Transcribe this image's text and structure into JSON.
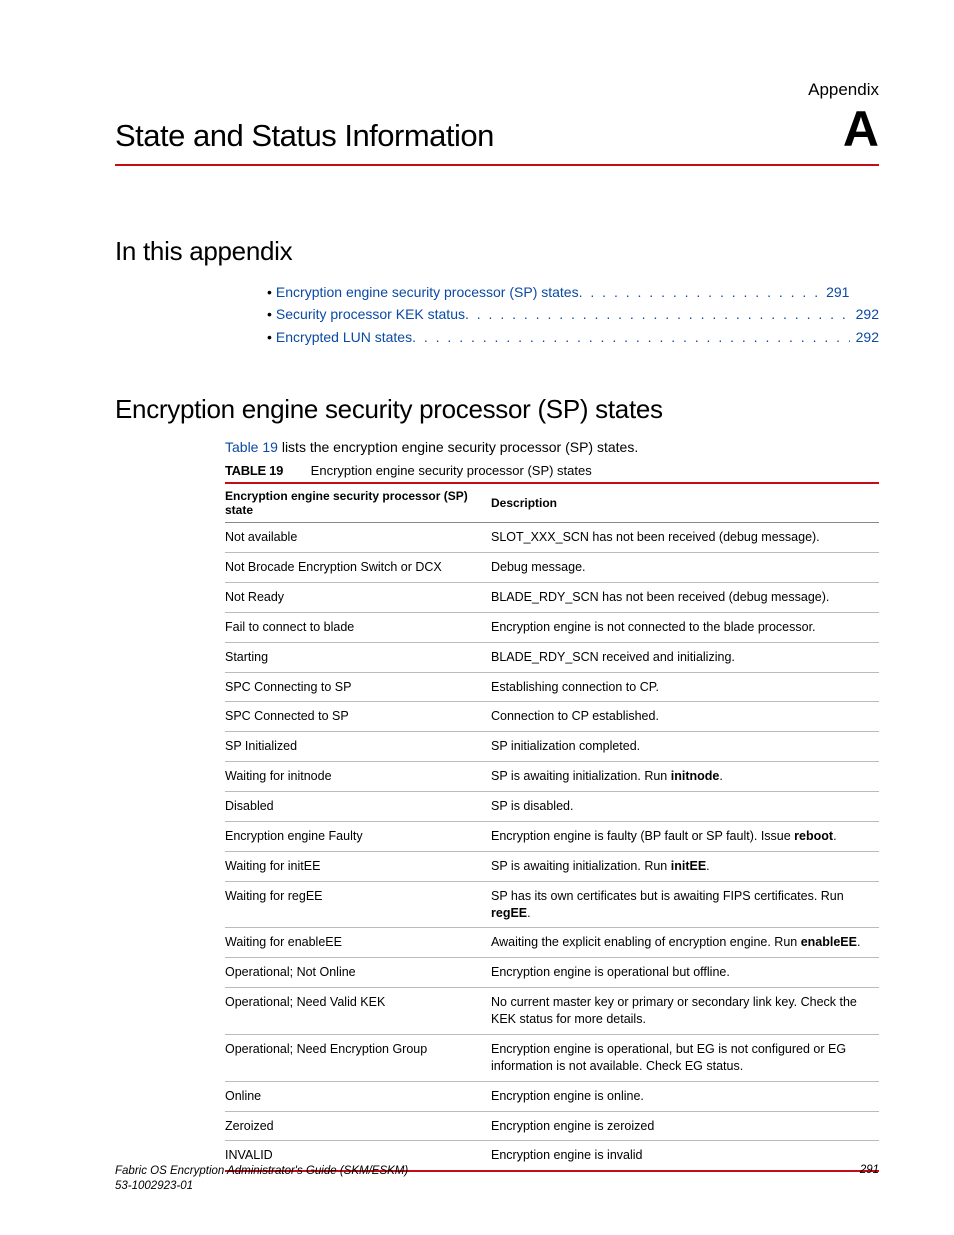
{
  "appendix_label": "Appendix",
  "chapter_title": "State and Status Information",
  "chapter_letter": "A",
  "toc_heading": "In this appendix",
  "toc": [
    {
      "label": "Encryption engine security processor (SP) states",
      "dots": ". . . . . . . . . . . . . . . . . . . . .",
      "page": "291"
    },
    {
      "label": "Security processor KEK status",
      "dots": " . . . . . . . . . . . . . . . . . . . . . . . . . . . . . . . . . . .",
      "page": "292"
    },
    {
      "label": "Encrypted LUN states",
      "dots": " . . . . . . . . . . . . . . . . . . . . . . . . . . . . . . . . . . . . . . . . . .",
      "page": "292"
    }
  ],
  "section_heading": "Encryption engine security processor (SP) states",
  "intro": {
    "link": "Table 19",
    "rest": " lists the encryption engine security processor (SP) states."
  },
  "table": {
    "number": "TABLE 19",
    "caption": "Encryption engine security processor (SP) states",
    "headers": {
      "state": "Encryption engine security processor (SP) state",
      "desc": "Description"
    },
    "rows": [
      {
        "state": "Not available",
        "desc": "SLOT_XXX_SCN has not been received (debug message)."
      },
      {
        "state": "Not Brocade Encryption Switch or DCX",
        "desc": "Debug message."
      },
      {
        "state": "Not Ready",
        "desc": "BLADE_RDY_SCN has not been received (debug message)."
      },
      {
        "state": "Fail to connect to blade",
        "desc": "Encryption engine is not connected to the blade processor."
      },
      {
        "state": "Starting",
        "desc": "BLADE_RDY_SCN received and initializing."
      },
      {
        "state": "SPC Connecting to SP",
        "desc": "Establishing connection to CP."
      },
      {
        "state": "SPC Connected to SP",
        "desc": "Connection to CP established."
      },
      {
        "state": "SP Initialized",
        "desc": "SP initialization completed."
      },
      {
        "state": "Waiting for initnode",
        "desc_pre": "SP is awaiting initialization. Run ",
        "desc_bold": "initnode",
        "desc_post": "."
      },
      {
        "state": "Disabled",
        "desc": "SP is disabled."
      },
      {
        "state": "Encryption engine Faulty",
        "desc_pre": "Encryption engine is faulty (BP fault or SP fault). Issue ",
        "desc_bold": "reboot",
        "desc_post": "."
      },
      {
        "state": "Waiting for initEE",
        "desc_pre": "SP is awaiting initialization. Run ",
        "desc_bold": "initEE",
        "desc_post": "."
      },
      {
        "state": "Waiting for regEE",
        "desc_pre": "SP has its own certificates but is awaiting FIPS certificates. Run ",
        "desc_bold": "regEE",
        "desc_post": "."
      },
      {
        "state": "Waiting for enableEE",
        "desc_pre": "Awaiting the explicit enabling of encryption engine. Run ",
        "desc_bold": "enableEE",
        "desc_post": "."
      },
      {
        "state": "Operational; Not Online",
        "desc": "Encryption engine is operational but offline."
      },
      {
        "state": "Operational; Need Valid KEK",
        "desc": "No current master key or primary or secondary link key. Check the KEK status for more details."
      },
      {
        "state": "Operational; Need Encryption Group",
        "desc": "Encryption engine is operational, but EG is not configured or EG information is not available. Check EG status."
      },
      {
        "state": "Online",
        "desc": "Encryption engine is online."
      },
      {
        "state": "Zeroized",
        "desc": "Encryption engine is zeroized"
      },
      {
        "state": "INVALID",
        "desc": "Encryption engine is invalid"
      }
    ]
  },
  "footer": {
    "title_line1": "Fabric OS Encryption Administrator's Guide (SKM/ESKM)",
    "title_line2": "53-1002923-01",
    "page": "291"
  }
}
